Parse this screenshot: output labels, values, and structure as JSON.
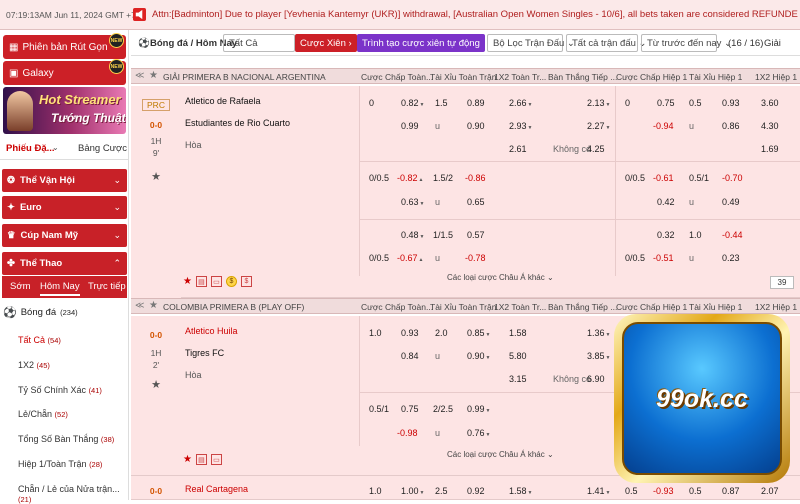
{
  "header": {
    "clock": "07:19:13AM Jun 11, 2024 GMT +7",
    "marquee": "Attn:[Badminton] Due to player [Yevhenia Kantemyr (UKR)] withdrawal, [Australian Open Women Singles - 10/6], all bets taken are considered REFUNDED. Parlay counted as one(1). Thank"
  },
  "sidebar": {
    "wallet_label": "Phiên bản Rút Gọn",
    "galaxy_label": "Galaxy",
    "new_tag": "NEW",
    "banner_line1": "Hot Streamer",
    "banner_line2": "Tướng Thuật",
    "tab_slip": "Phiếu Đặ...",
    "tab_board": "Bảng Cược",
    "sections": [
      {
        "label": "Thể Vận Hội"
      },
      {
        "label": "Euro"
      },
      {
        "label": "Cúp Nam Mỹ"
      },
      {
        "label": "Thể Thao"
      }
    ],
    "subtabs": [
      "Sớm",
      "Hôm Nay",
      "Trực tiếp"
    ],
    "sport": "Bóng đá",
    "sport_count": "(234)",
    "filters": [
      {
        "label": "Tất Cả",
        "count": "(54)"
      },
      {
        "label": "1X2",
        "count": "(45)"
      },
      {
        "label": "Tỷ Số Chính Xác",
        "count": "(41)"
      },
      {
        "label": "Lẻ/Chẵn",
        "count": "(52)"
      },
      {
        "label": "Tổng Số Bàn Thắng",
        "count": "(38)"
      },
      {
        "label": "Hiệp 1/Toàn Trận",
        "count": "(28)"
      },
      {
        "label": "Chẵn / Lẻ của Nửa trận...",
        "count": "(21)"
      }
    ]
  },
  "toolbar": {
    "title": "Bóng đá / Hôm Nay",
    "filter_all": "Tất Cả",
    "parlay": "Cược Xiên",
    "create_parlay": "Trình tạo cược xiên tự động",
    "league_filter": "Bộ Lọc Trận Đấu",
    "all_matches": "Tất cả trận đấu",
    "sort": "Từ trước đến nay",
    "pages": "(16 / 16)",
    "odds_type": "Giải"
  },
  "columns": [
    "Cược Chấp Toàn...",
    "Tài Xỉu Toàn Trận",
    "1X2 Toàn Tr...",
    "Bàn Thắng Tiếp ...",
    "Cược Chấp Hiệp 1",
    "Tài Xỉu Hiệp 1",
    "1X2 Hiệp 1"
  ],
  "league1": {
    "name": "GIẢI PRIMERA B NACIONAL ARGENTINA",
    "stamp": "PRC",
    "score": "0-0",
    "period": "1H",
    "minute": "9'",
    "home": "Atletico de Rafaela",
    "away": "Estudiantes de Rio Cuarto",
    "draw": "Hòa",
    "row1": [
      "0",
      "0.82",
      "1.5",
      "0.89",
      "2.66",
      "2.13",
      "0",
      "0.75",
      "0.5",
      "0.93",
      "3.60"
    ],
    "row2": [
      "0.99",
      "u",
      "0.90",
      "2.93",
      "2.27",
      "-0.94",
      "u",
      "0.86",
      "4.30"
    ],
    "row3": [
      "2.61",
      "Không có",
      "4.25",
      "1.69"
    ],
    "alt1": [
      "0/0.5",
      "-0.82",
      "1.5/2",
      "-0.86",
      "0/0.5",
      "-0.61",
      "0.5/1",
      "-0.70"
    ],
    "alt1b": [
      "0.63",
      "u",
      "0.65",
      "0.42",
      "u",
      "0.49"
    ],
    "alt2": [
      "0.48",
      "1/1.5",
      "0.57",
      "0.32",
      "1.0",
      "-0.44"
    ],
    "alt2b": [
      "0/0.5",
      "-0.67",
      "u",
      "-0.78",
      "0/0.5",
      "-0.51",
      "u",
      "0.23"
    ],
    "more": "Các loại cược Châu Á khác",
    "page": "39"
  },
  "league2": {
    "name": "COLOMBIA PRIMERA B (PLAY OFF)",
    "score": "0-0",
    "period": "1H",
    "minute": "2'",
    "home": "Atletico Huila",
    "away": "Tigres FC",
    "draw": "Hòa",
    "row1": [
      "1.0",
      "0.93",
      "2.0",
      "0.85",
      "1.58",
      "1.36"
    ],
    "row2": [
      "0.84",
      "u",
      "0.90",
      "5.80",
      "3.85"
    ],
    "row3": [
      "3.15",
      "Không có",
      "6.90"
    ],
    "alt": [
      "0.5/1",
      "0.75",
      "2/2.5",
      "0.99"
    ],
    "altb": [
      "-0.98",
      "u",
      "0.76"
    ],
    "more": "Các loại cược Châu Á khác",
    "next_score": "0-0",
    "next_team": "Real Cartagena",
    "next_row": [
      "1.0",
      "1.00",
      "2.5",
      "0.92",
      "1.58",
      "1.41",
      "0.5",
      "-0.93",
      "0.5",
      "0.87",
      "2.07"
    ]
  },
  "logo": {
    "text": "99ok.cc"
  },
  "colors": {
    "brand_red": "#cc2027",
    "pink_bg": "#fde4e4",
    "logo_blue": "#0c6fd1"
  }
}
